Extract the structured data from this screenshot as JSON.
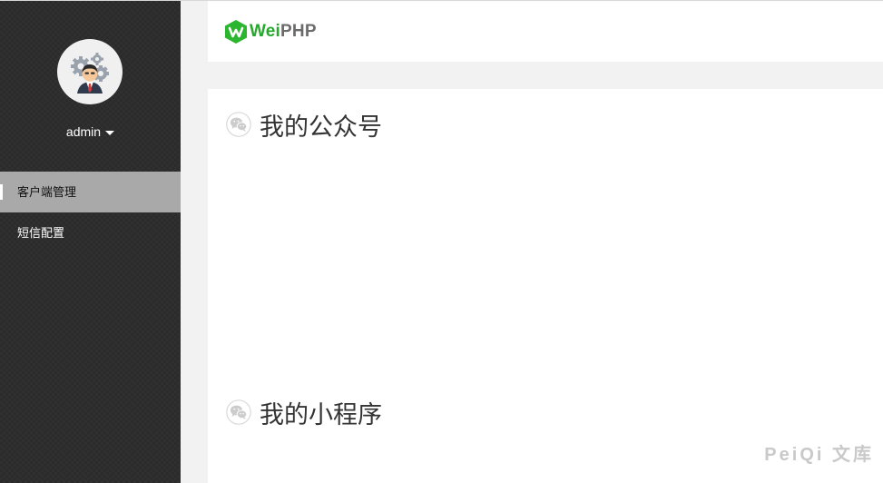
{
  "sidebar": {
    "user": {
      "name": "admin"
    },
    "items": [
      {
        "label": "客户端管理",
        "active": true
      },
      {
        "label": "短信配置",
        "active": false
      }
    ]
  },
  "header": {
    "logo": {
      "part1": "Wei",
      "part2": "PHP"
    }
  },
  "main": {
    "sections": [
      {
        "title": "我的公众号",
        "icon": "wechat-icon"
      },
      {
        "title": "我的小程序",
        "icon": "wechat-icon"
      }
    ]
  },
  "watermark": "PeiQi 文库",
  "colors": {
    "sidebar_bg": "#2b2b2b",
    "active_item_bg": "#a9a9a9",
    "brand_green": "#26a82d",
    "page_bg": "#f2f2f2"
  }
}
